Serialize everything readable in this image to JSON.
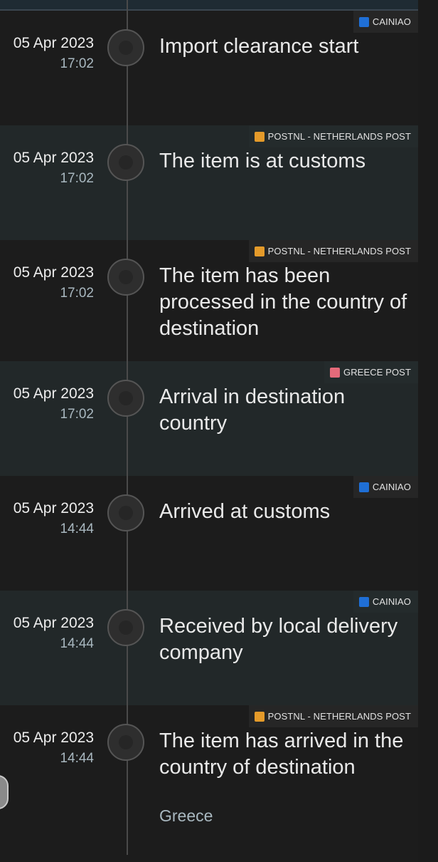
{
  "events": [
    {
      "carrier": "CAINIAO",
      "carrier_logo": "cainiao-logo-icon",
      "date": "05 Apr 2023",
      "time": "17:02",
      "title": "Import clearance start",
      "subtitle": ""
    },
    {
      "carrier": "POSTNL - NETHERLANDS POST",
      "carrier_logo": "postnl-logo-icon",
      "date": "05 Apr 2023",
      "time": "17:02",
      "title": "The item is at customs",
      "subtitle": ""
    },
    {
      "carrier": "POSTNL - NETHERLANDS POST",
      "carrier_logo": "postnl-logo-icon",
      "date": "05 Apr 2023",
      "time": "17:02",
      "title": "The item has been processed in the country of destination",
      "subtitle": ""
    },
    {
      "carrier": "GREECE POST",
      "carrier_logo": "greece-post-logo-icon",
      "date": "05 Apr 2023",
      "time": "17:02",
      "title": "Arrival in destination country",
      "subtitle": ""
    },
    {
      "carrier": "CAINIAO",
      "carrier_logo": "cainiao-logo-icon",
      "date": "05 Apr 2023",
      "time": "14:44",
      "title": "Arrived at customs",
      "subtitle": ""
    },
    {
      "carrier": "CAINIAO",
      "carrier_logo": "cainiao-logo-icon",
      "date": "05 Apr 2023",
      "time": "14:44",
      "title": "Received by local delivery company",
      "subtitle": ""
    },
    {
      "carrier": "POSTNL - NETHERLANDS POST",
      "carrier_logo": "postnl-logo-icon",
      "date": "05 Apr 2023",
      "time": "14:44",
      "title": "The item has arrived in the country of destination",
      "subtitle": "Greece"
    }
  ],
  "colors": {
    "background": "#1b1b1b",
    "alt_row": "#222829",
    "timeline_line": "#4a4a4a",
    "cainiao": "#1f6fd6",
    "postnl": "#e49a2a",
    "greece_post": "#e46a7a"
  }
}
